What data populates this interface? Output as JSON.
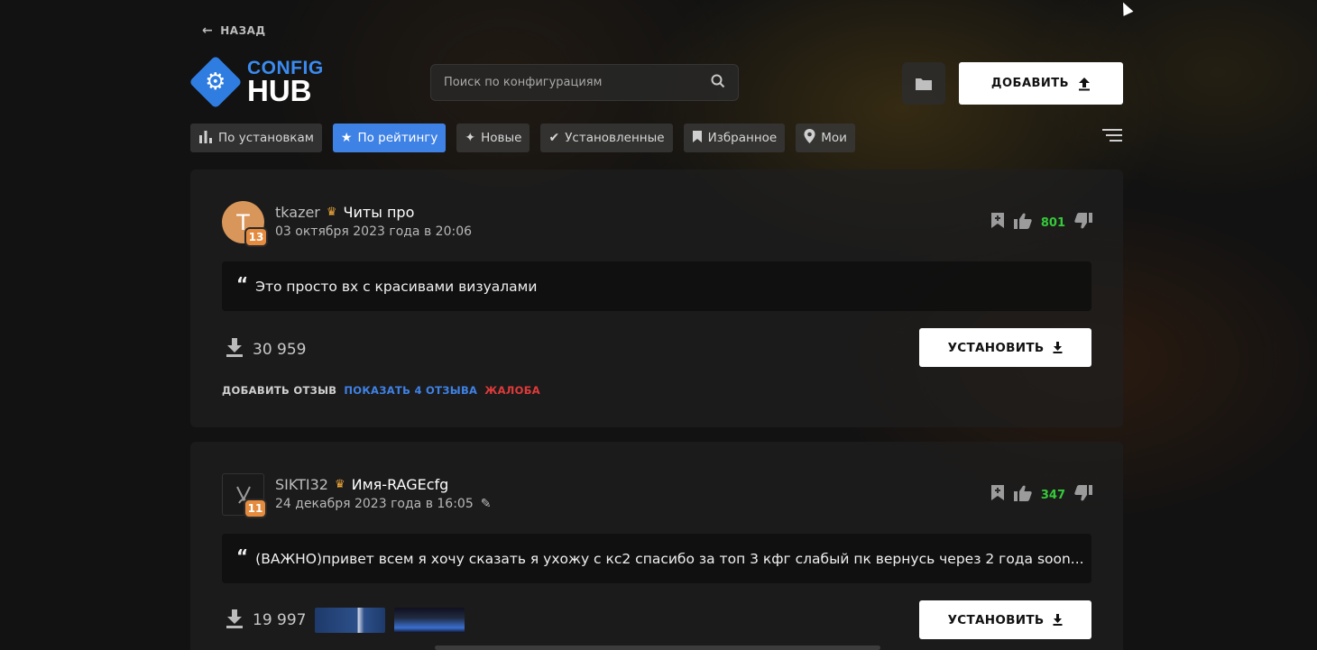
{
  "header": {
    "back_label": "НАЗАД",
    "logo_top": "CONFIG",
    "logo_bottom": "HUB",
    "search_placeholder": "Поиск по конфигурациям",
    "add_label": "ДОБАВИТЬ"
  },
  "tabs": [
    {
      "label": "По установкам",
      "icon": "bar-chart-icon",
      "active": false
    },
    {
      "label": "По рейтингу",
      "icon": "star-icon",
      "active": true
    },
    {
      "label": "Новые",
      "icon": "sparkle-icon",
      "active": false
    },
    {
      "label": "Установленные",
      "icon": "check-icon",
      "active": false
    },
    {
      "label": "Избранное",
      "icon": "bookmark-icon",
      "active": false
    },
    {
      "label": "Мои",
      "icon": "pin-icon",
      "active": false
    }
  ],
  "configs": [
    {
      "avatar_letter": "T",
      "level": "13",
      "author": "tkazer",
      "name": "Читы про",
      "date": "03 октября 2023 года в 20:06",
      "rating": "801",
      "description": "Это просто вх с красивами визуалами",
      "downloads": "30 959",
      "install_label": "УСТАНОВИТЬ",
      "add_review": "ДОБАВИТЬ ОТЗЫВ",
      "show_reviews": "ПОКАЗАТЬ 4 ОТЗЫВА",
      "report": "ЖАЛОБА"
    },
    {
      "level": "11",
      "author": "SIKTI32",
      "name": "Имя-RAGEcfg",
      "date": "24 декабря 2023 года в 16:05",
      "rating": "347",
      "description": "(ВАЖНО)привет всем я хочу сказать я ухожу с кс2 спасибо за топ 3 кфг слабый пк вернусь через 2 года soon...",
      "downloads": "19 997",
      "install_label": "УСТАНОВИТЬ"
    }
  ],
  "colors": {
    "accent": "#3f82e6",
    "rating_positive": "#35c93a",
    "report": "#e03a3a",
    "level_badge": "#e58b3f"
  }
}
